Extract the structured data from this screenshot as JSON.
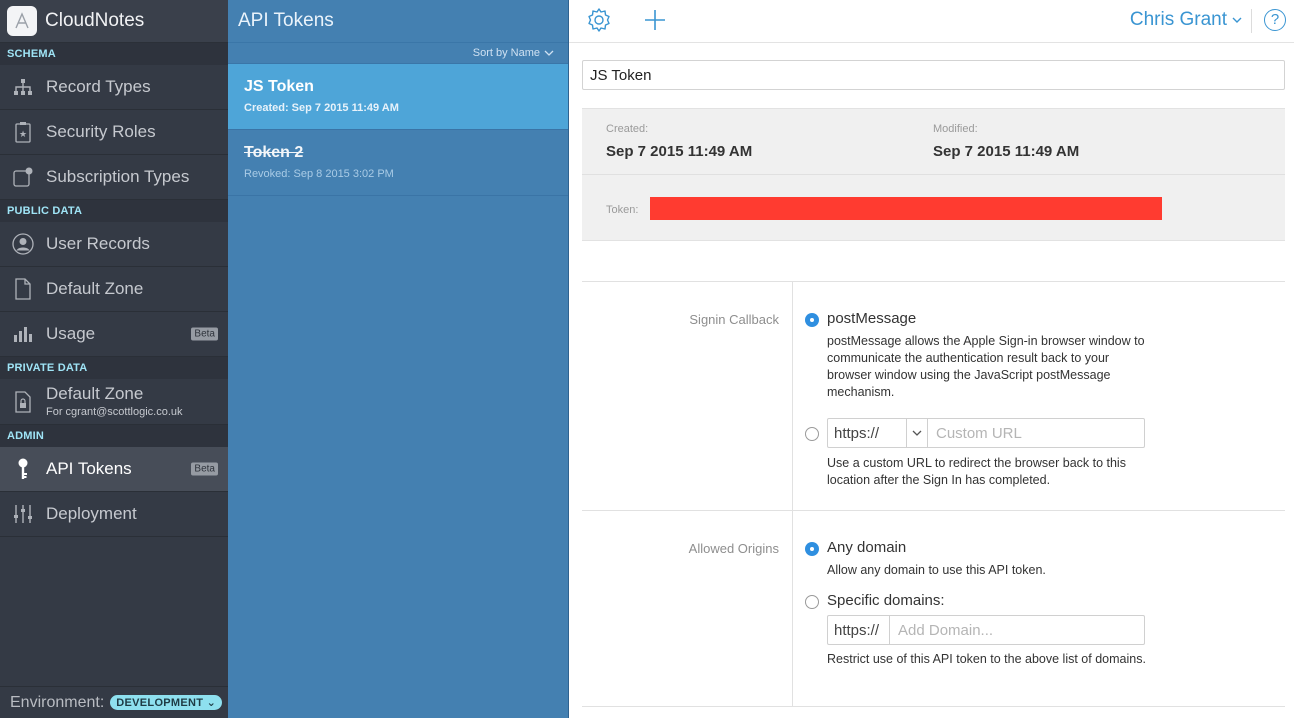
{
  "sidebar": {
    "app_name": "CloudNotes",
    "sections": {
      "schema": "SCHEMA",
      "public": "PUBLIC DATA",
      "private": "PRIVATE DATA",
      "admin": "ADMIN"
    },
    "items": {
      "record_types": "Record Types",
      "security_roles": "Security Roles",
      "subscription_types": "Subscription Types",
      "user_records": "User Records",
      "public_default_zone": "Default Zone",
      "usage": "Usage",
      "usage_badge": "Beta",
      "private_default_zone": "Default Zone",
      "private_default_zone_sub": "For cgrant@scottlogic.co.uk",
      "api_tokens": "API Tokens",
      "api_tokens_badge": "Beta",
      "deployment": "Deployment"
    },
    "footer": {
      "env_label": "Environment:",
      "env_value": "DEVELOPMENT"
    }
  },
  "list": {
    "title": "API Tokens",
    "sort_label": "Sort by Name",
    "tokens": [
      {
        "name": "JS Token",
        "sub": "Created: Sep 7 2015 11:49 AM"
      },
      {
        "name": "Token 2",
        "sub": "Revoked: Sep 8 2015 3:02 PM"
      }
    ]
  },
  "toolbar": {
    "user_name": "Chris Grant",
    "help_glyph": "?"
  },
  "detail": {
    "token_name": "JS Token",
    "created_label": "Created:",
    "created_value": "Sep 7 2015 11:49 AM",
    "modified_label": "Modified:",
    "modified_value": "Sep 7 2015 11:49 AM",
    "token_label": "Token:",
    "redaction_color": "#ff3b30",
    "signin": {
      "label": "Signin Callback",
      "option1_title": "postMessage",
      "option1_desc": "postMessage allows the Apple Sign-in browser window to communicate the authentication result back to your browser window using the JavaScript postMessage mechanism.",
      "url_scheme": "https://",
      "url_placeholder": "Custom URL",
      "option2_desc": "Use a custom URL to redirect the browser back to this location after the Sign In has completed."
    },
    "origins": {
      "label": "Allowed Origins",
      "option1_title": "Any domain",
      "option1_desc": "Allow any domain to use this API token.",
      "option2_title": "Specific domains:",
      "domain_prefix": "https://",
      "domain_placeholder": "Add Domain...",
      "option2_desc": "Restrict use of this API token to the above list of domains."
    }
  },
  "colors": {
    "sidebar_bg": "#343a45",
    "list_bg": "#4480b1",
    "selected_row": "#4ea5d8",
    "accent": "#3a95d2",
    "radio_on": "#2f8fe0"
  }
}
